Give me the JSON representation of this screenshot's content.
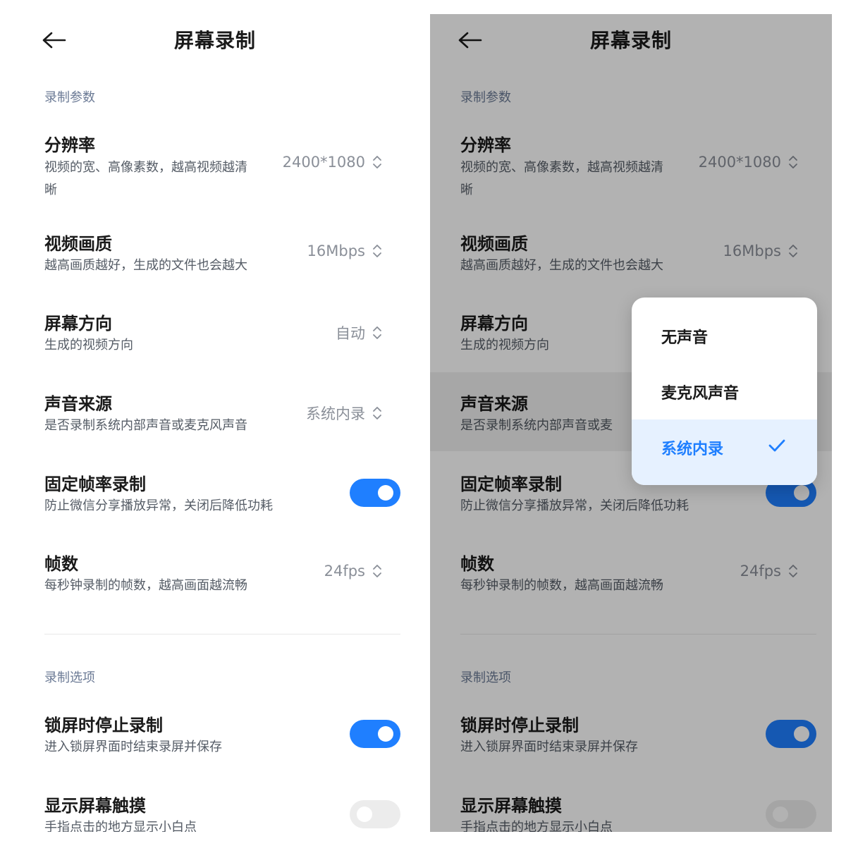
{
  "header": {
    "title": "屏幕录制",
    "back_icon": "arrow-left-icon"
  },
  "sections": {
    "record_params": "录制参数",
    "record_options": "录制选项"
  },
  "settings": {
    "resolution": {
      "title": "分辨率",
      "sub_line1": "视频的宽、高像素数，越高视频越清",
      "sub_line2": "晰",
      "value": "2400*1080"
    },
    "quality": {
      "title": "视频画质",
      "sub": "越高画质越好，生成的文件也会越大",
      "value": "16Mbps"
    },
    "orientation": {
      "title": "屏幕方向",
      "sub": "生成的视频方向",
      "value": "自动"
    },
    "audio_source": {
      "title": "声音来源",
      "sub": "是否录制系统内部声音或麦克风声音",
      "sub_truncated": "是否录制系统内部声音或麦",
      "value": "系统内录"
    },
    "fixed_framerate": {
      "title": "固定帧率录制",
      "sub": "防止微信分享播放异常，关闭后降低功耗",
      "enabled": true
    },
    "framerate": {
      "title": "帧数",
      "sub": "每秒钟录制的帧数，越高画面越流畅",
      "value": "24fps"
    },
    "stop_on_lock": {
      "title": "锁屏时停止录制",
      "sub": "进入锁屏界面时结束录屏并保存",
      "enabled": true
    },
    "show_touches": {
      "title": "显示屏幕触摸",
      "sub": "手指点击的地方显示小白点",
      "enabled": false
    }
  },
  "audio_dropdown": {
    "options": [
      "无声音",
      "麦克风声音",
      "系统内录"
    ],
    "selected": "系统内录"
  },
  "colors": {
    "accent": "#1f7fff",
    "section_label": "#6b7a95",
    "toggle_off": "#ececec"
  }
}
